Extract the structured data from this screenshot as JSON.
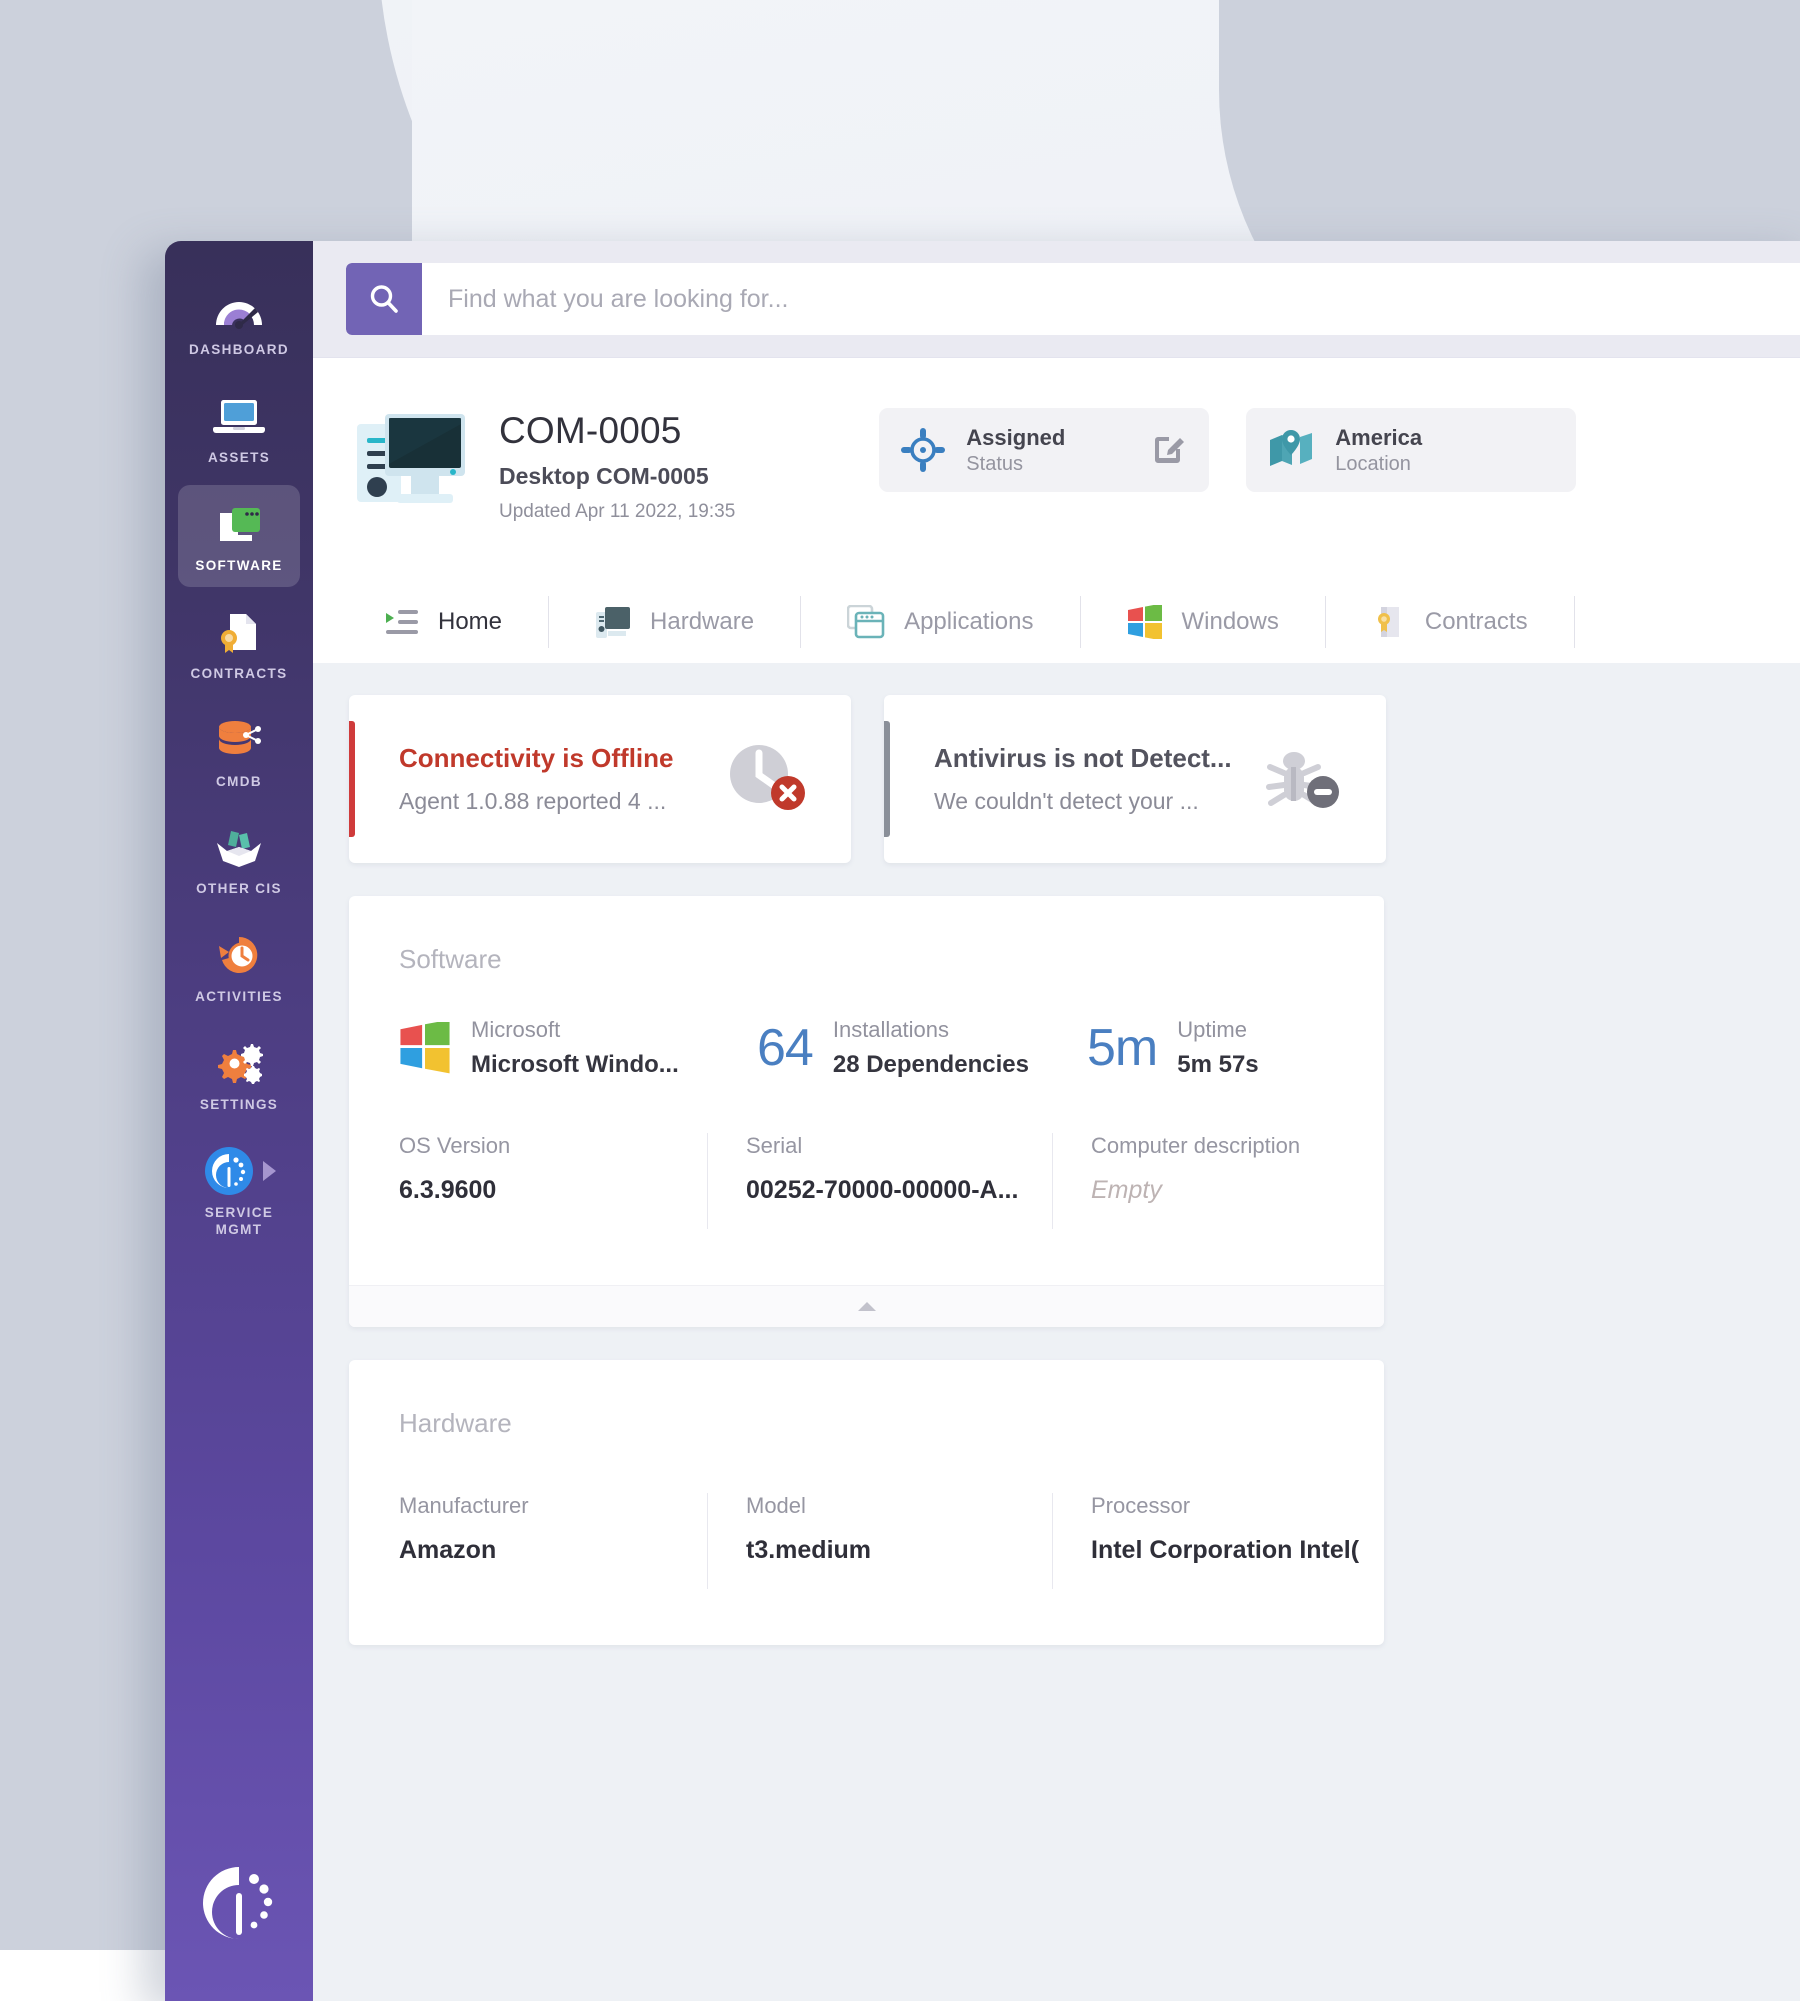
{
  "sidebar": {
    "items": [
      {
        "label": "DASHBOARD",
        "icon": "gauge-icon",
        "active": false
      },
      {
        "label": "ASSETS",
        "icon": "laptop-icon",
        "active": false
      },
      {
        "label": "SOFTWARE",
        "icon": "software-window-icon",
        "active": true
      },
      {
        "label": "CONTRACTS",
        "icon": "certificate-document-icon",
        "active": false
      },
      {
        "label": "CMDB",
        "icon": "database-nodes-icon",
        "active": false
      },
      {
        "label": "OTHER CIS",
        "icon": "open-box-icon",
        "active": false
      },
      {
        "label": "ACTIVITIES",
        "icon": "clock-history-icon",
        "active": false
      },
      {
        "label": "SETTINGS",
        "icon": "gears-icon",
        "active": false
      },
      {
        "label": "SERVICE MGMT",
        "icon": "service-logo-icon",
        "active": false
      }
    ],
    "brand_logo": "invgate-logo-icon"
  },
  "search": {
    "placeholder": "Find what you are looking for...",
    "value": "",
    "icon": "search-icon"
  },
  "asset": {
    "icon": "desktop-computer-icon",
    "name": "COM-0005",
    "subtitle": "Desktop COM-0005",
    "updated": "Updated Apr 11 2022, 19:35"
  },
  "badges": [
    {
      "icon": "crosshair-target-icon",
      "value": "Assigned",
      "label": "Status",
      "edit_icon": "edit-pencil-icon",
      "accent": "#3a7fc0"
    },
    {
      "icon": "map-location-icon",
      "value": "America",
      "label": "Location",
      "accent": "#3f98a8"
    }
  ],
  "tabs": [
    {
      "label": "Home",
      "icon": "list-home-icon",
      "active": true
    },
    {
      "label": "Hardware",
      "icon": "hardware-tower-icon",
      "active": false
    },
    {
      "label": "Applications",
      "icon": "applications-window-icon",
      "active": false
    },
    {
      "label": "Windows",
      "icon": "windows-logo-icon",
      "active": false
    },
    {
      "label": "Contracts",
      "icon": "certificate-scroll-icon",
      "active": false
    }
  ],
  "alerts": [
    {
      "title": "Connectivity is Offline",
      "description": "Agent 1.0.88 reported 4 ...",
      "icon": "clock-error-icon",
      "severity_color": "#cf3b3b",
      "title_color": "#c0392b"
    },
    {
      "title": "Antivirus is not Detect...",
      "description": "We couldn't detect your ...",
      "icon": "bug-minus-icon",
      "severity_color": "#8a8f99",
      "title_color": "#53535e"
    }
  ],
  "software_panel": {
    "title": "Software",
    "stats": [
      {
        "icon": "windows-logo-icon",
        "top": "Microsoft",
        "bottom": "Microsoft Windo...",
        "big": ""
      },
      {
        "big": "64",
        "top": "Installations",
        "bottom": "28 Dependencies"
      },
      {
        "big": "5m",
        "top": "Uptime",
        "bottom": "5m 57s"
      }
    ],
    "fields": [
      {
        "label": "OS Version",
        "value": "6.3.9600",
        "empty": false
      },
      {
        "label": "Serial",
        "value": "00252-70000-00000-A...",
        "empty": false
      },
      {
        "label": "Computer description",
        "value": "Empty",
        "empty": true
      }
    ],
    "collapse_icon": "collapse-caret-icon"
  },
  "hardware_panel": {
    "title": "Hardware",
    "fields": [
      {
        "label": "Manufacturer",
        "value": "Amazon"
      },
      {
        "label": "Model",
        "value": "t3.medium"
      },
      {
        "label": "Processor",
        "value": "Intel Corporation Intel("
      }
    ]
  },
  "colors": {
    "sidebar_top": "#38305a",
    "sidebar_bottom": "#6b55b4",
    "search_accent": "#7264b5",
    "content_bg": "#eef1f5",
    "danger": "#cf3b3b",
    "stat_blue": "#4a7fc1"
  }
}
